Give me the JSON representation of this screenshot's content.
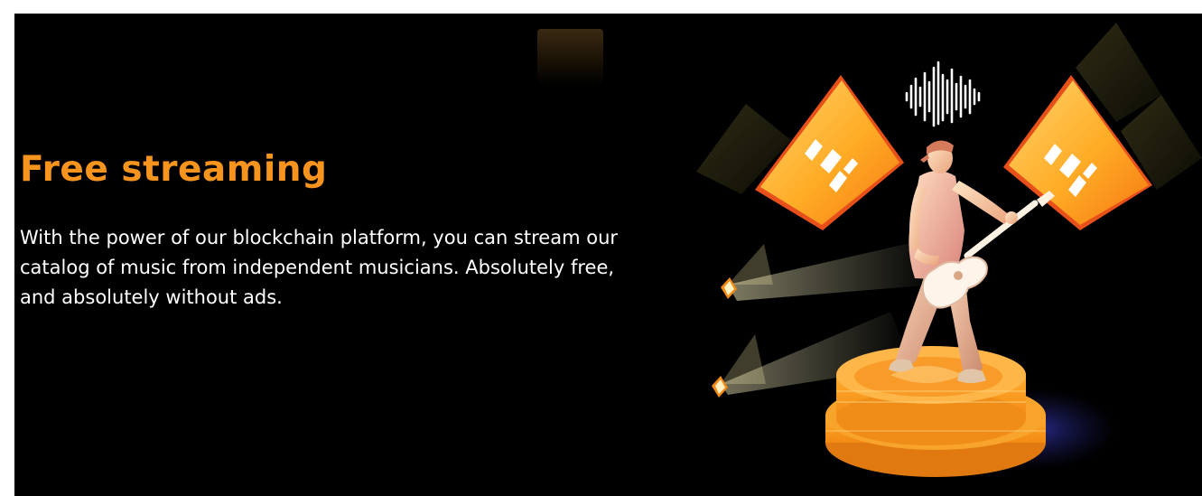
{
  "feature": {
    "title": "Free streaming",
    "description": "With the power of our blockchain platform, you can stream our catalog of music from independent musicians. Absolutely free, and absolutely without ads."
  },
  "colors": {
    "background": "#000000",
    "accent": "#f7941d",
    "text": "#ffffff"
  },
  "illustration": {
    "icon": "guitarist-on-coin-stage-illustration"
  }
}
